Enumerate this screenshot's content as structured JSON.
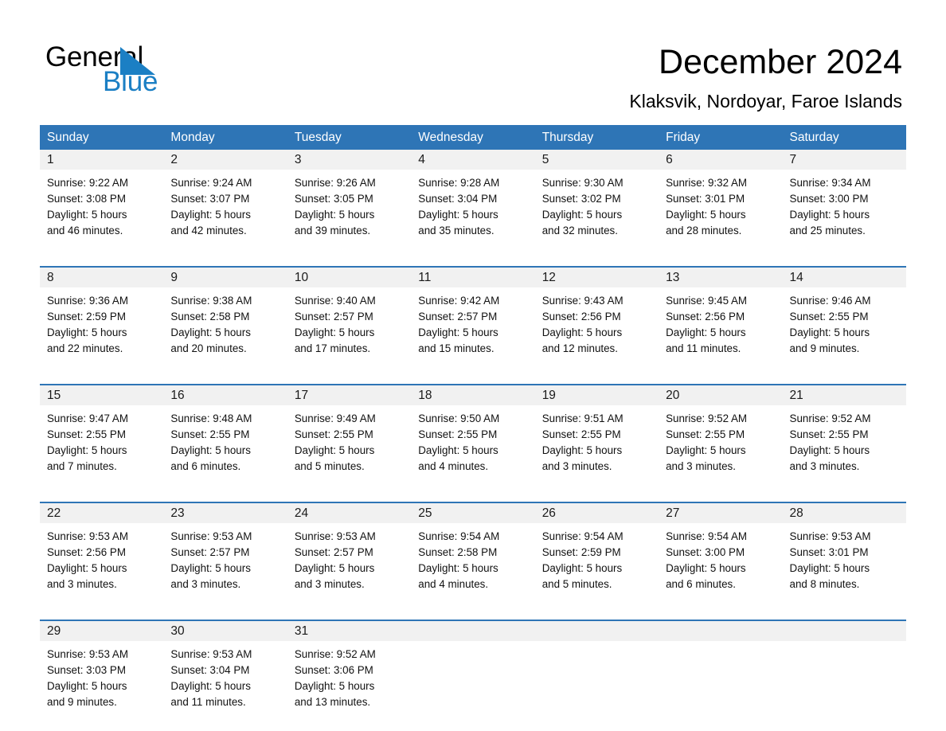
{
  "brand": {
    "name_part1": "General",
    "name_part2": "Blue",
    "triangle_icon": "triangle-icon",
    "accent_color": "#1b7fc4"
  },
  "header": {
    "title": "December 2024",
    "subtitle": "Klaksvik, Nordoyar, Faroe Islands",
    "header_bg_color": "#2e75b6",
    "day_number_bg_color": "#f1f1f1"
  },
  "weekday_headers": [
    "Sunday",
    "Monday",
    "Tuesday",
    "Wednesday",
    "Thursday",
    "Friday",
    "Saturday"
  ],
  "weeks": [
    {
      "days": [
        {
          "number": "1",
          "sunrise": "Sunrise: 9:22 AM",
          "sunset": "Sunset: 3:08 PM",
          "daylight_l1": "Daylight: 5 hours",
          "daylight_l2": "and 46 minutes."
        },
        {
          "number": "2",
          "sunrise": "Sunrise: 9:24 AM",
          "sunset": "Sunset: 3:07 PM",
          "daylight_l1": "Daylight: 5 hours",
          "daylight_l2": "and 42 minutes."
        },
        {
          "number": "3",
          "sunrise": "Sunrise: 9:26 AM",
          "sunset": "Sunset: 3:05 PM",
          "daylight_l1": "Daylight: 5 hours",
          "daylight_l2": "and 39 minutes."
        },
        {
          "number": "4",
          "sunrise": "Sunrise: 9:28 AM",
          "sunset": "Sunset: 3:04 PM",
          "daylight_l1": "Daylight: 5 hours",
          "daylight_l2": "and 35 minutes."
        },
        {
          "number": "5",
          "sunrise": "Sunrise: 9:30 AM",
          "sunset": "Sunset: 3:02 PM",
          "daylight_l1": "Daylight: 5 hours",
          "daylight_l2": "and 32 minutes."
        },
        {
          "number": "6",
          "sunrise": "Sunrise: 9:32 AM",
          "sunset": "Sunset: 3:01 PM",
          "daylight_l1": "Daylight: 5 hours",
          "daylight_l2": "and 28 minutes."
        },
        {
          "number": "7",
          "sunrise": "Sunrise: 9:34 AM",
          "sunset": "Sunset: 3:00 PM",
          "daylight_l1": "Daylight: 5 hours",
          "daylight_l2": "and 25 minutes."
        }
      ]
    },
    {
      "days": [
        {
          "number": "8",
          "sunrise": "Sunrise: 9:36 AM",
          "sunset": "Sunset: 2:59 PM",
          "daylight_l1": "Daylight: 5 hours",
          "daylight_l2": "and 22 minutes."
        },
        {
          "number": "9",
          "sunrise": "Sunrise: 9:38 AM",
          "sunset": "Sunset: 2:58 PM",
          "daylight_l1": "Daylight: 5 hours",
          "daylight_l2": "and 20 minutes."
        },
        {
          "number": "10",
          "sunrise": "Sunrise: 9:40 AM",
          "sunset": "Sunset: 2:57 PM",
          "daylight_l1": "Daylight: 5 hours",
          "daylight_l2": "and 17 minutes."
        },
        {
          "number": "11",
          "sunrise": "Sunrise: 9:42 AM",
          "sunset": "Sunset: 2:57 PM",
          "daylight_l1": "Daylight: 5 hours",
          "daylight_l2": "and 15 minutes."
        },
        {
          "number": "12",
          "sunrise": "Sunrise: 9:43 AM",
          "sunset": "Sunset: 2:56 PM",
          "daylight_l1": "Daylight: 5 hours",
          "daylight_l2": "and 12 minutes."
        },
        {
          "number": "13",
          "sunrise": "Sunrise: 9:45 AM",
          "sunset": "Sunset: 2:56 PM",
          "daylight_l1": "Daylight: 5 hours",
          "daylight_l2": "and 11 minutes."
        },
        {
          "number": "14",
          "sunrise": "Sunrise: 9:46 AM",
          "sunset": "Sunset: 2:55 PM",
          "daylight_l1": "Daylight: 5 hours",
          "daylight_l2": "and 9 minutes."
        }
      ]
    },
    {
      "days": [
        {
          "number": "15",
          "sunrise": "Sunrise: 9:47 AM",
          "sunset": "Sunset: 2:55 PM",
          "daylight_l1": "Daylight: 5 hours",
          "daylight_l2": "and 7 minutes."
        },
        {
          "number": "16",
          "sunrise": "Sunrise: 9:48 AM",
          "sunset": "Sunset: 2:55 PM",
          "daylight_l1": "Daylight: 5 hours",
          "daylight_l2": "and 6 minutes."
        },
        {
          "number": "17",
          "sunrise": "Sunrise: 9:49 AM",
          "sunset": "Sunset: 2:55 PM",
          "daylight_l1": "Daylight: 5 hours",
          "daylight_l2": "and 5 minutes."
        },
        {
          "number": "18",
          "sunrise": "Sunrise: 9:50 AM",
          "sunset": "Sunset: 2:55 PM",
          "daylight_l1": "Daylight: 5 hours",
          "daylight_l2": "and 4 minutes."
        },
        {
          "number": "19",
          "sunrise": "Sunrise: 9:51 AM",
          "sunset": "Sunset: 2:55 PM",
          "daylight_l1": "Daylight: 5 hours",
          "daylight_l2": "and 3 minutes."
        },
        {
          "number": "20",
          "sunrise": "Sunrise: 9:52 AM",
          "sunset": "Sunset: 2:55 PM",
          "daylight_l1": "Daylight: 5 hours",
          "daylight_l2": "and 3 minutes."
        },
        {
          "number": "21",
          "sunrise": "Sunrise: 9:52 AM",
          "sunset": "Sunset: 2:55 PM",
          "daylight_l1": "Daylight: 5 hours",
          "daylight_l2": "and 3 minutes."
        }
      ]
    },
    {
      "days": [
        {
          "number": "22",
          "sunrise": "Sunrise: 9:53 AM",
          "sunset": "Sunset: 2:56 PM",
          "daylight_l1": "Daylight: 5 hours",
          "daylight_l2": "and 3 minutes."
        },
        {
          "number": "23",
          "sunrise": "Sunrise: 9:53 AM",
          "sunset": "Sunset: 2:57 PM",
          "daylight_l1": "Daylight: 5 hours",
          "daylight_l2": "and 3 minutes."
        },
        {
          "number": "24",
          "sunrise": "Sunrise: 9:53 AM",
          "sunset": "Sunset: 2:57 PM",
          "daylight_l1": "Daylight: 5 hours",
          "daylight_l2": "and 3 minutes."
        },
        {
          "number": "25",
          "sunrise": "Sunrise: 9:54 AM",
          "sunset": "Sunset: 2:58 PM",
          "daylight_l1": "Daylight: 5 hours",
          "daylight_l2": "and 4 minutes."
        },
        {
          "number": "26",
          "sunrise": "Sunrise: 9:54 AM",
          "sunset": "Sunset: 2:59 PM",
          "daylight_l1": "Daylight: 5 hours",
          "daylight_l2": "and 5 minutes."
        },
        {
          "number": "27",
          "sunrise": "Sunrise: 9:54 AM",
          "sunset": "Sunset: 3:00 PM",
          "daylight_l1": "Daylight: 5 hours",
          "daylight_l2": "and 6 minutes."
        },
        {
          "number": "28",
          "sunrise": "Sunrise: 9:53 AM",
          "sunset": "Sunset: 3:01 PM",
          "daylight_l1": "Daylight: 5 hours",
          "daylight_l2": "and 8 minutes."
        }
      ]
    },
    {
      "days": [
        {
          "number": "29",
          "sunrise": "Sunrise: 9:53 AM",
          "sunset": "Sunset: 3:03 PM",
          "daylight_l1": "Daylight: 5 hours",
          "daylight_l2": "and 9 minutes."
        },
        {
          "number": "30",
          "sunrise": "Sunrise: 9:53 AM",
          "sunset": "Sunset: 3:04 PM",
          "daylight_l1": "Daylight: 5 hours",
          "daylight_l2": "and 11 minutes."
        },
        {
          "number": "31",
          "sunrise": "Sunrise: 9:52 AM",
          "sunset": "Sunset: 3:06 PM",
          "daylight_l1": "Daylight: 5 hours",
          "daylight_l2": "and 13 minutes."
        },
        {
          "number": "",
          "sunrise": "",
          "sunset": "",
          "daylight_l1": "",
          "daylight_l2": ""
        },
        {
          "number": "",
          "sunrise": "",
          "sunset": "",
          "daylight_l1": "",
          "daylight_l2": ""
        },
        {
          "number": "",
          "sunrise": "",
          "sunset": "",
          "daylight_l1": "",
          "daylight_l2": ""
        },
        {
          "number": "",
          "sunrise": "",
          "sunset": "",
          "daylight_l1": "",
          "daylight_l2": ""
        }
      ]
    }
  ]
}
